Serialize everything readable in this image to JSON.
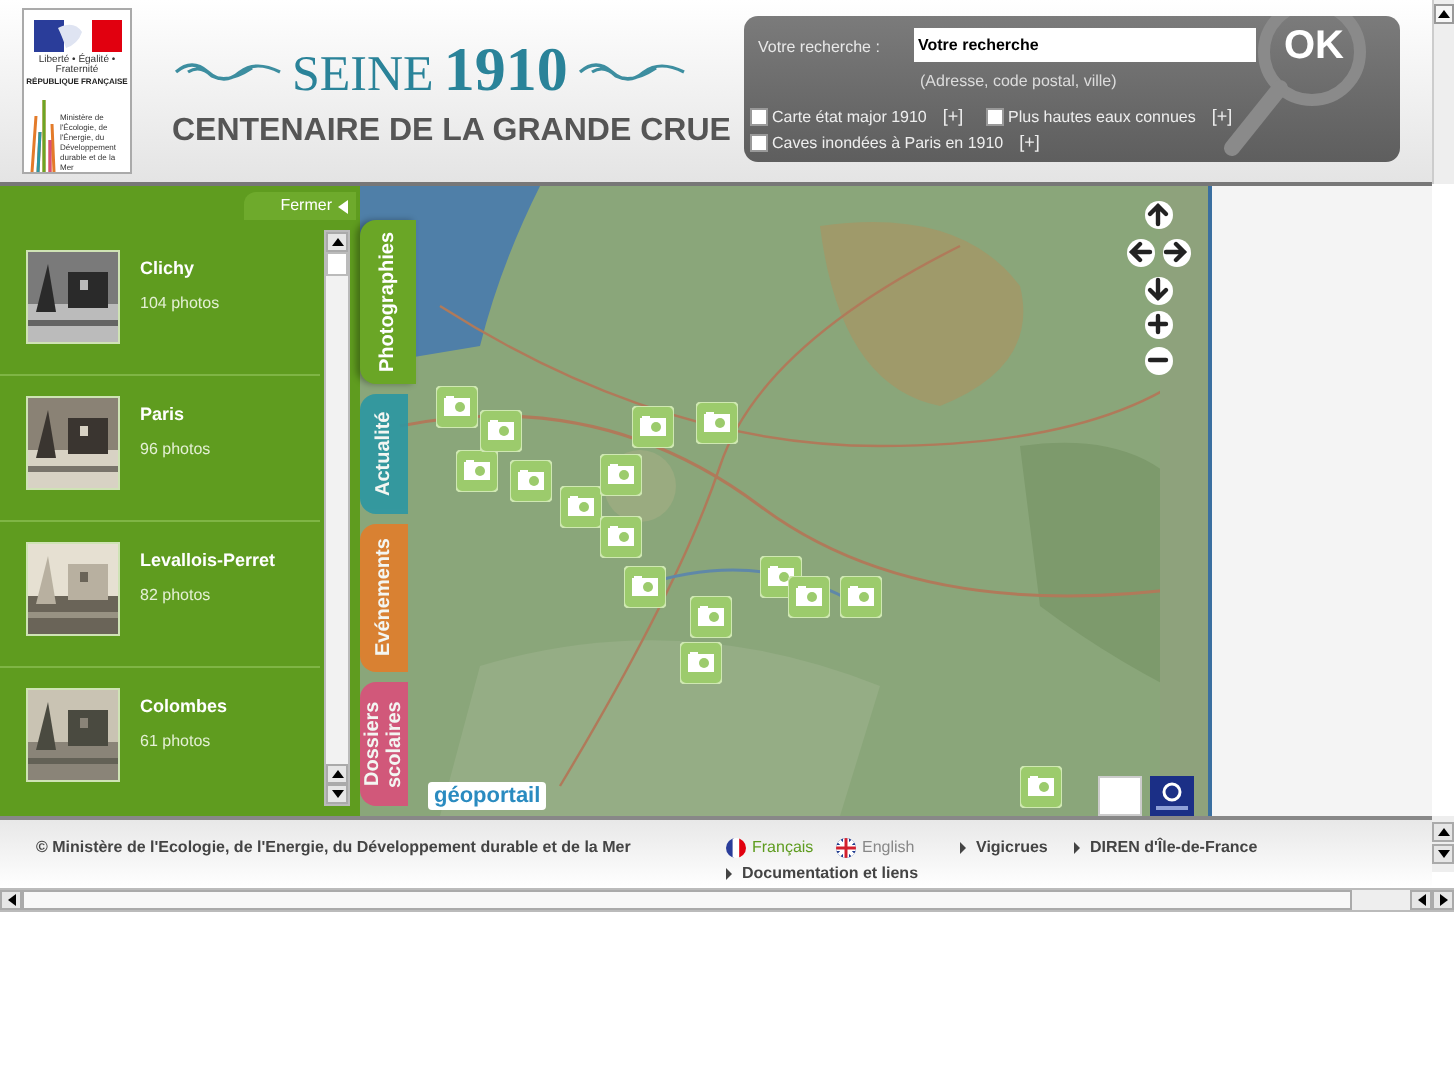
{
  "header": {
    "logo": {
      "motto": "Liberté • Égalité • Fraternité",
      "republic": "RÉPUBLIQUE FRANÇAISE",
      "ministry": "Ministère de l'Écologie, de l'Énergie, du Développement durable et de la Mer"
    },
    "title_word": "SEINE",
    "title_year": "1910",
    "subtitle": "CENTENAIRE DE LA GRANDE CRUE"
  },
  "search": {
    "label": "Votre recherche :",
    "value": "Votre recherche",
    "hint": "(Adresse, code postal, ville)",
    "button": "OK",
    "layers": [
      {
        "label": "Carte état major 1910",
        "more": "[+]",
        "checked": false
      },
      {
        "label": "Plus hautes eaux connues",
        "more": "[+]",
        "checked": false
      },
      {
        "label": "Caves inondées à Paris en 1910",
        "more": "[+]",
        "checked": false
      }
    ]
  },
  "panel": {
    "close": "Fermer",
    "items": [
      {
        "name": "Clichy",
        "count": "104 photos"
      },
      {
        "name": "Paris",
        "count": "96 photos"
      },
      {
        "name": "Levallois-Perret",
        "count": "82 photos"
      },
      {
        "name": "Colombes",
        "count": "61 photos"
      }
    ]
  },
  "tabs": [
    {
      "label": "Photographies",
      "selected": true,
      "color": "#6aa626"
    },
    {
      "label": "Actualité",
      "selected": false,
      "color": "#2b97a3"
    },
    {
      "label": "Evénements",
      "selected": false,
      "color": "#e27d2b"
    },
    {
      "label": "Dossiers scolaires",
      "selected": false,
      "color": "#d9507a"
    }
  ],
  "map": {
    "provider": "géoportail"
  },
  "footer": {
    "copyright": "© Ministère de l'Ecologie, de l'Energie, du Développement durable et de la Mer",
    "languages": [
      {
        "label": "Français",
        "selected": true
      },
      {
        "label": "English",
        "selected": false
      }
    ],
    "links": [
      "Vigicrues",
      "DIREN d'Île-de-France",
      "Documentation et liens"
    ]
  }
}
